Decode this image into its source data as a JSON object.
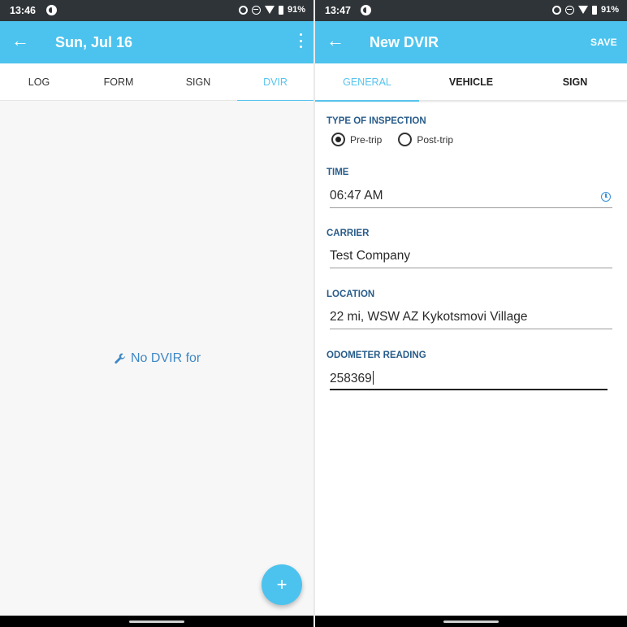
{
  "left": {
    "status": {
      "time": "13:46",
      "battery": "91%"
    },
    "appbar": {
      "title": "Sun, Jul 16"
    },
    "tabs": [
      {
        "label": "LOG"
      },
      {
        "label": "FORM"
      },
      {
        "label": "SIGN"
      },
      {
        "label": "DVIR",
        "active": true
      }
    ],
    "empty_message": "No DVIR for",
    "fab_label": "+",
    "icons": {
      "back": "arrow-left-icon",
      "menu": "more-vert-icon",
      "empty": "wrench-icon"
    }
  },
  "right": {
    "status": {
      "time": "13:47",
      "battery": "91%"
    },
    "appbar": {
      "title": "New DVIR",
      "save_label": "SAVE"
    },
    "tabs": [
      {
        "label": "GENERAL",
        "active": true
      },
      {
        "label": "VEHICLE"
      },
      {
        "label": "SIGN"
      }
    ],
    "form": {
      "inspection_type": {
        "label": "TYPE OF INSPECTION",
        "options": [
          "Pre-trip",
          "Post-trip"
        ],
        "selected": "Pre-trip"
      },
      "time": {
        "label": "TIME",
        "value": "06:47 AM"
      },
      "carrier": {
        "label": "CARRIER",
        "value": "Test Company"
      },
      "location": {
        "label": "LOCATION",
        "value": "22 mi, WSW AZ Kykotsmovi Village"
      },
      "odometer": {
        "label": "ODOMETER READING",
        "value": "258369"
      }
    }
  },
  "colors": {
    "appbar": "#4cc3ee",
    "statusbar": "#2f3438",
    "active_tab": "#57c4ee",
    "field_label": "#285c8a",
    "empty_message": "#3f88c5"
  }
}
